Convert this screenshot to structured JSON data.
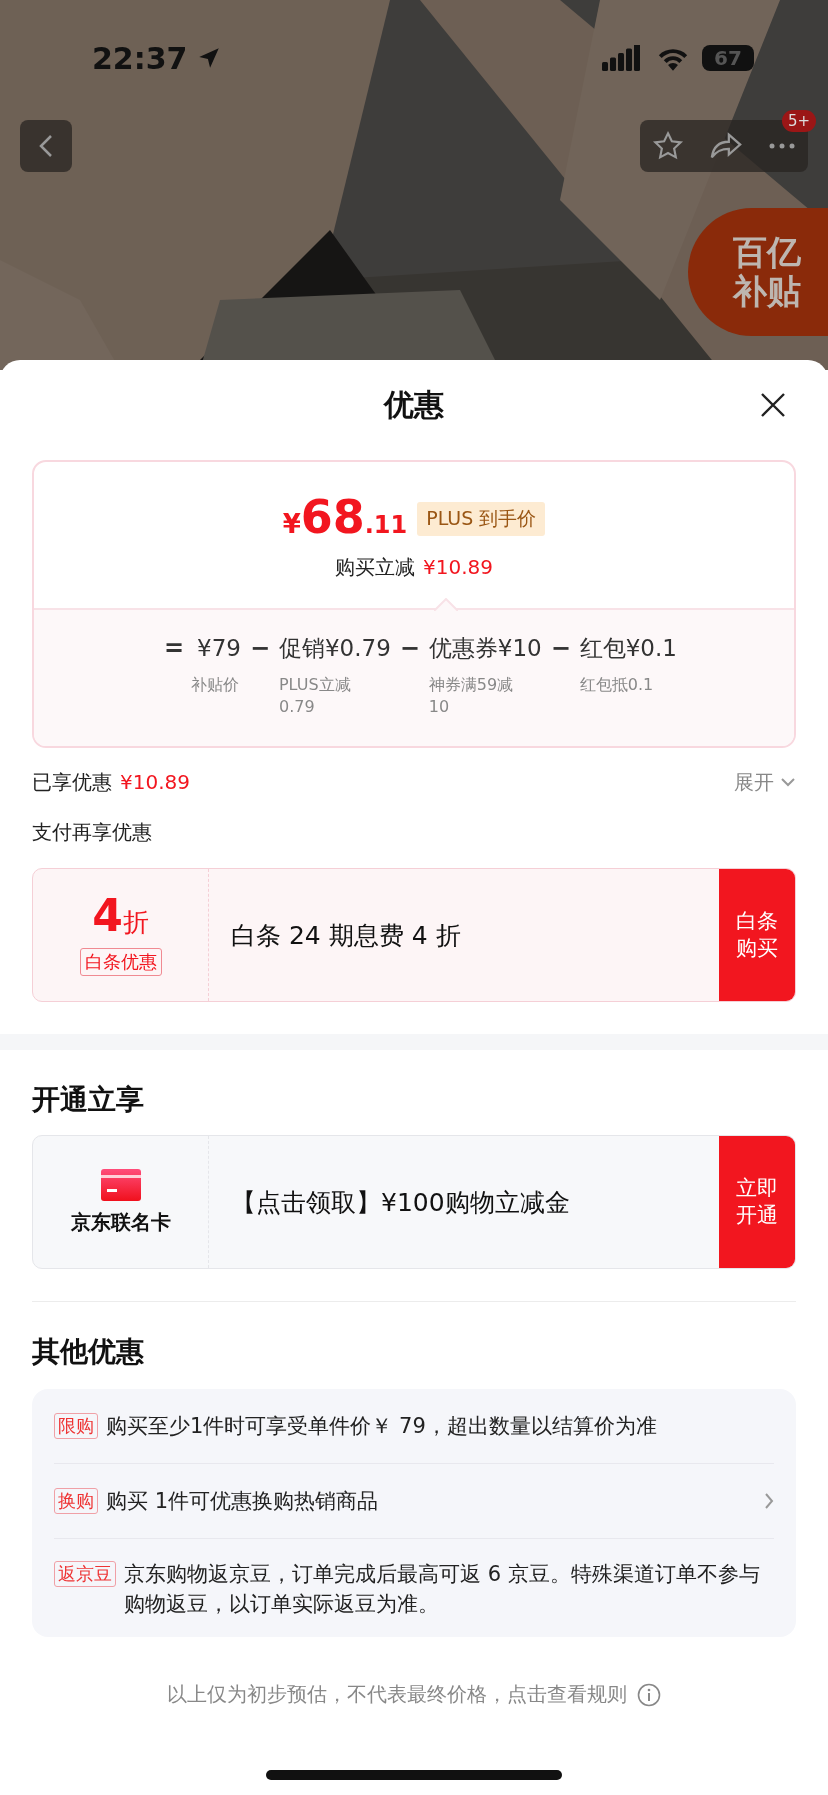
{
  "status_bar": {
    "time": "22:37",
    "battery": "67"
  },
  "nav": {
    "badge": "5+"
  },
  "subsidy_badge": {
    "lines": [
      "百亿",
      "补贴"
    ]
  },
  "sheet": {
    "title": "优惠"
  },
  "price_card": {
    "currency": "¥",
    "integer": "68",
    "decimal": ".11",
    "tag": "PLUS 到手价",
    "saving_label": "购买立减",
    "saving_amount": "¥10.89",
    "breakdown": [
      {
        "operator": "=",
        "amount": "¥79",
        "note": "补贴价"
      },
      {
        "operator": "−",
        "amount": "促销¥0.79",
        "note": "PLUS立减0.79"
      },
      {
        "operator": "−",
        "amount": "优惠券¥10",
        "note": "神券满59减10"
      },
      {
        "operator": "−",
        "amount": "红包¥0.1",
        "note": "红包抵0.1"
      }
    ]
  },
  "enjoyed": {
    "label": "已享优惠",
    "amount": "¥10.89",
    "toggle": "展开"
  },
  "pay_section": {
    "title": "支付再享优惠",
    "offer": {
      "value": "4",
      "unit": "折",
      "tag": "白条优惠",
      "text": "白条 24 期息费 4 折",
      "button": "白条购买"
    }
  },
  "open_section": {
    "title": "开通立享",
    "offer": {
      "card_name": "京东联名卡",
      "text": "【点击领取】¥100购物立减金",
      "button": "立即开通"
    }
  },
  "other_section": {
    "title": "其他优惠",
    "rows": [
      {
        "tag": "限购",
        "text": "购买至少1件时可享受单件价￥ 79，超出数量以结算价为准",
        "has_arrow": false
      },
      {
        "tag": "换购",
        "text": "购买 1件可优惠换购热销商品",
        "has_arrow": true
      },
      {
        "tag": "返京豆",
        "text": "京东购物返京豆，订单完成后最高可返 6 京豆。特殊渠道订单不参与购物返豆，以订单实际返豆为准。",
        "has_arrow": false
      }
    ]
  },
  "footer": {
    "text": "以上仅为初步预估，不代表最终价格，点击查看规则"
  }
}
